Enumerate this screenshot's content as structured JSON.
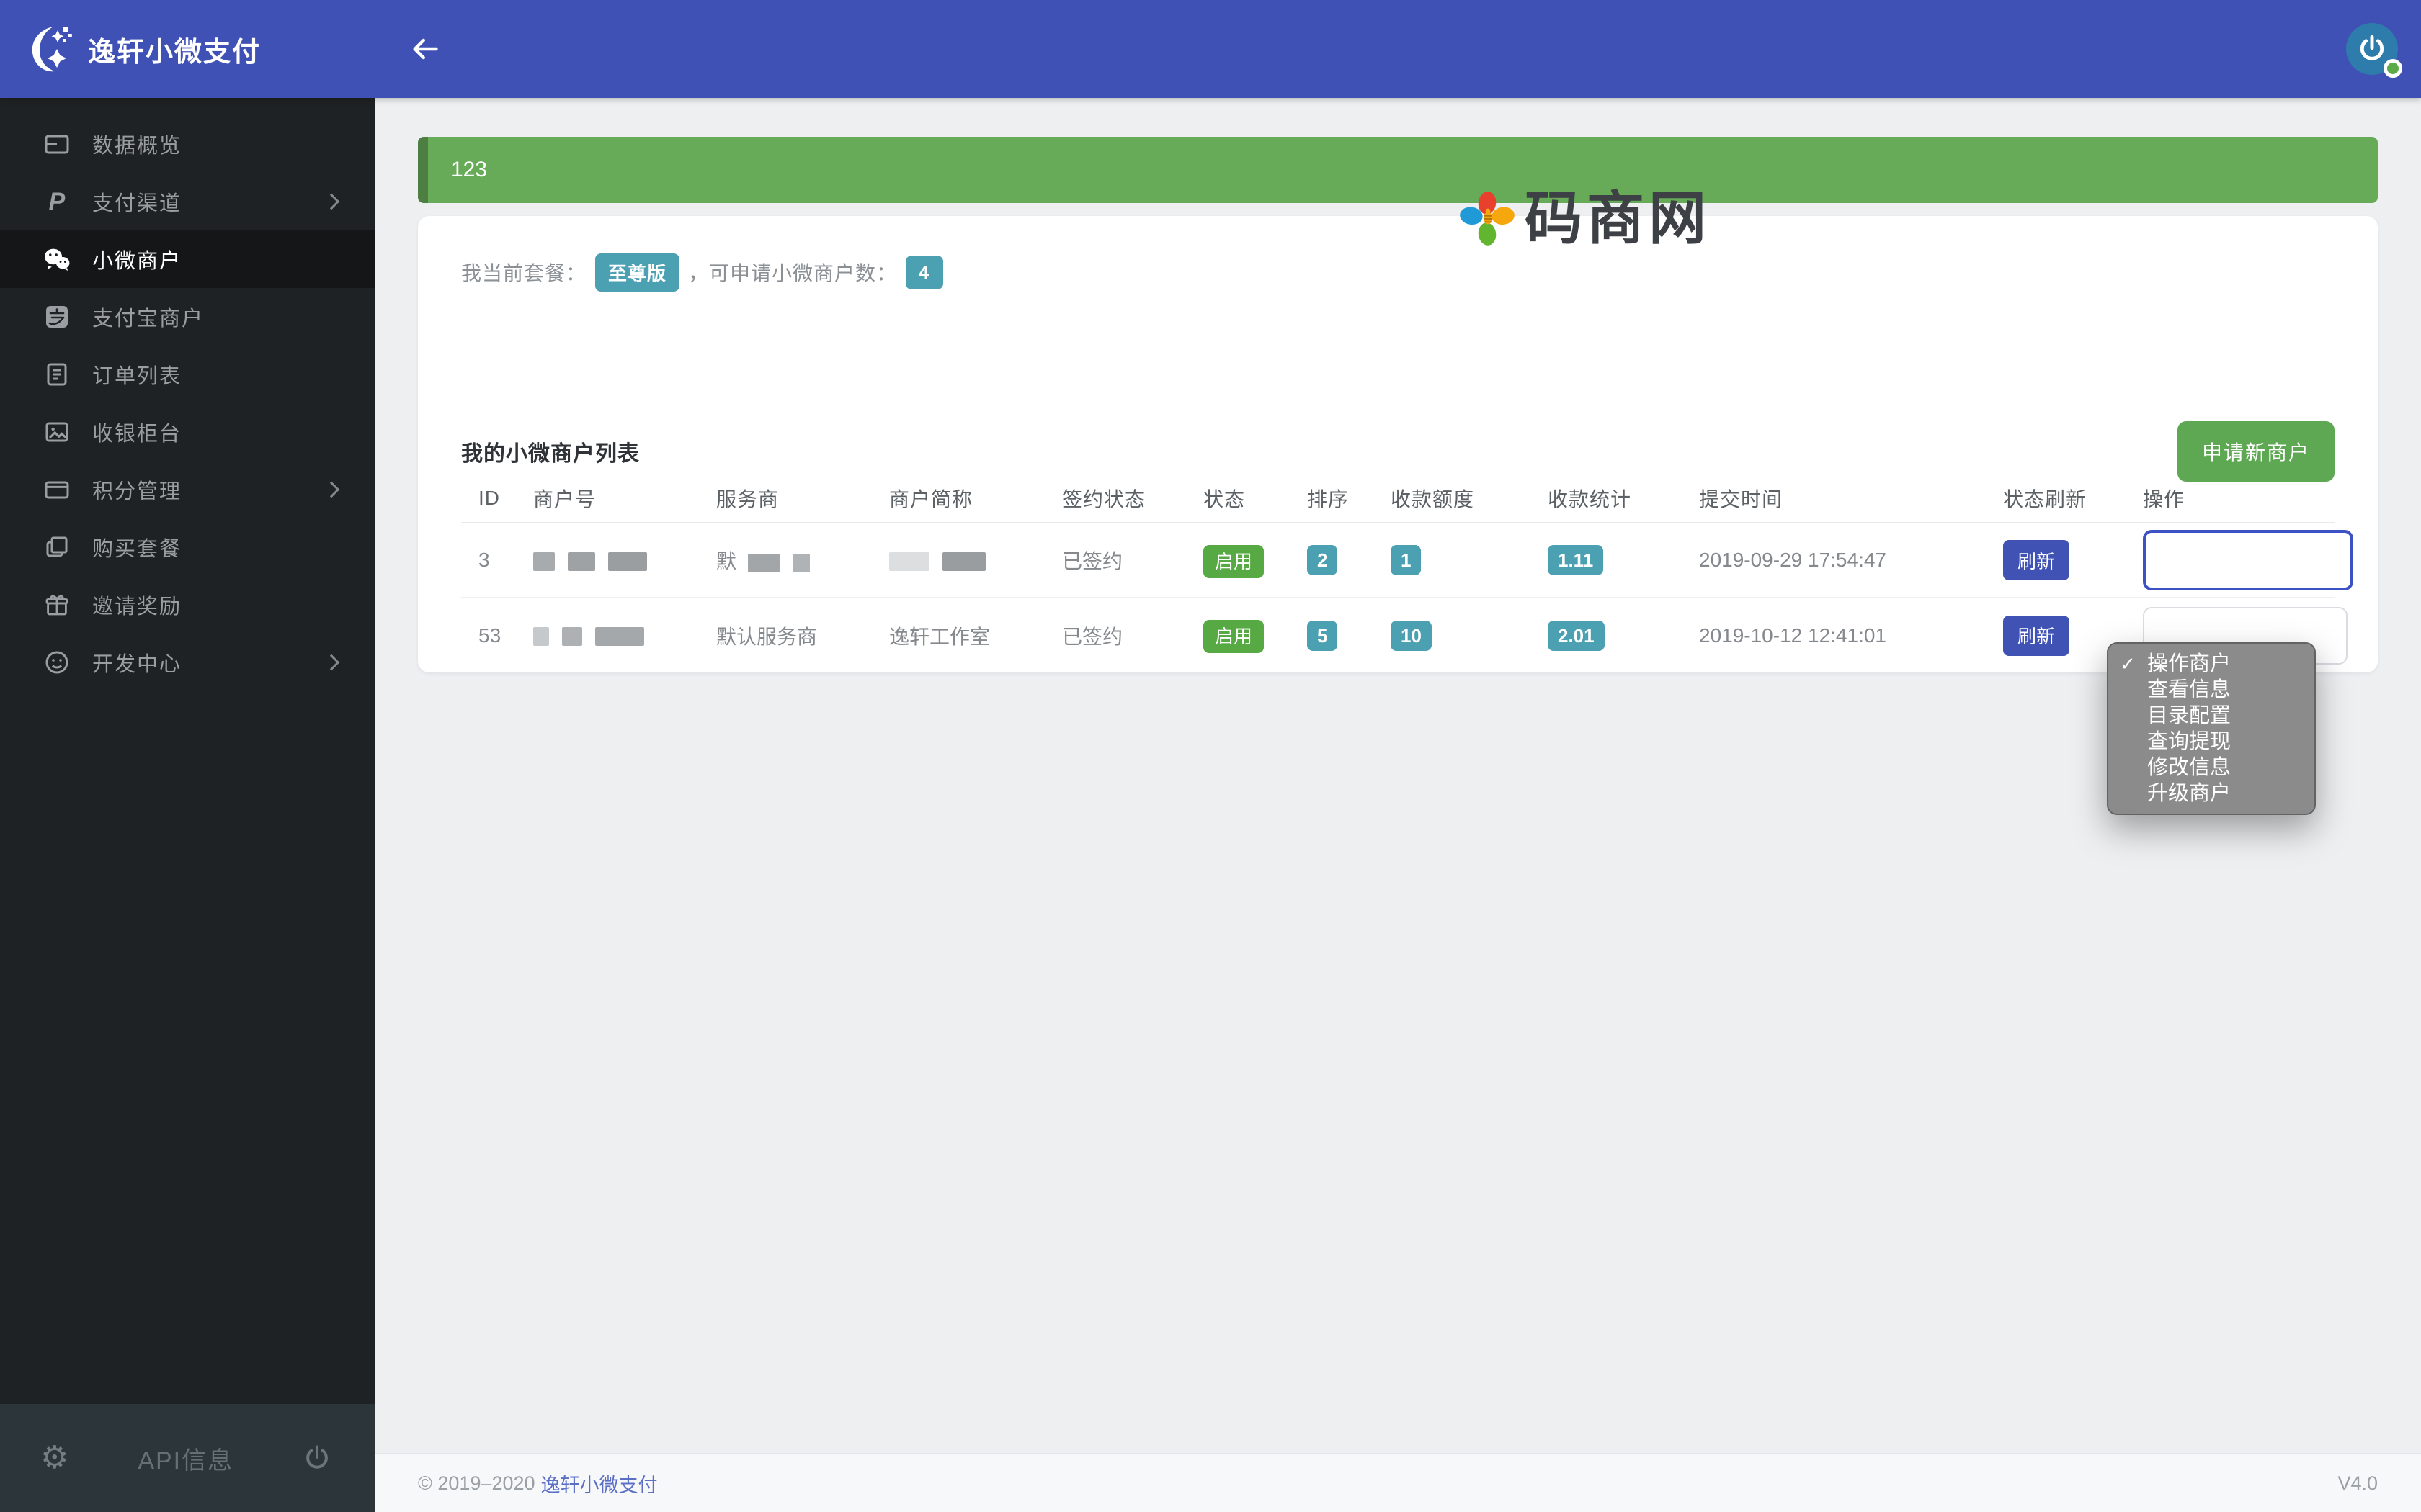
{
  "topbar": {
    "brand": "逸轩小微支付"
  },
  "sidebar": {
    "items": [
      {
        "label": "数据概览",
        "icon": "data-overview-card-icon"
      },
      {
        "label": "支付渠道",
        "icon": "paypal-p-icon",
        "chevron": true
      },
      {
        "label": "小微商户",
        "icon": "wechat-icon",
        "active": true
      },
      {
        "label": "支付宝商户",
        "icon": "alipay-icon"
      },
      {
        "label": "订单列表",
        "icon": "order-list-icon"
      },
      {
        "label": "收银柜台",
        "icon": "cashier-picture-icon"
      },
      {
        "label": "积分管理",
        "icon": "points-card-icon",
        "chevron": true
      },
      {
        "label": "购买套餐",
        "icon": "buy-package-icon"
      },
      {
        "label": "邀请奖励",
        "icon": "gift-icon"
      },
      {
        "label": "开发中心",
        "icon": "dev-center-smiley-icon",
        "chevron": true
      }
    ],
    "bottom": {
      "api_label": "API信息",
      "icons": [
        "gear-icon",
        "power-icon"
      ]
    }
  },
  "banner": {
    "text": "123"
  },
  "watermark": {
    "text": "码商网",
    "petal_colors": [
      "#e8402d",
      "#1f9ad6",
      "#f5a70d",
      "#62b52e"
    ]
  },
  "plan": {
    "prefix": "我当前套餐：",
    "plan_badge": "至尊版",
    "middle": "，可申请小微商户数：",
    "count_badge": "4"
  },
  "merchant_table": {
    "title": "我的小微商户列表",
    "new_button": "申请新商户",
    "columns": [
      "ID",
      "商户号",
      "服务商",
      "商户简称",
      "签约状态",
      "状态",
      "排序",
      "收款额度",
      "收款统计",
      "提交时间",
      "状态刷新",
      "操作"
    ],
    "rows": [
      {
        "id": "3",
        "provider_prefix": "默",
        "sign_status": "已签约",
        "status": "启用",
        "sort": "2",
        "quota": "1",
        "stats": "1.11",
        "submitted": "2019-09-29 17:54:47",
        "refresh": "刷新"
      },
      {
        "id": "53",
        "provider": "默认服务商",
        "short_name": "逸轩工作室",
        "sign_status": "已签约",
        "status": "启用",
        "sort": "5",
        "quota": "10",
        "stats": "2.01",
        "submitted": "2019-10-12 12:41:01",
        "refresh": "刷新"
      }
    ]
  },
  "action_menu": {
    "check": "✓",
    "options": [
      {
        "label": "操作商户",
        "checked": true
      },
      {
        "label": "查看信息"
      },
      {
        "label": "目录配置"
      },
      {
        "label": "查询提现"
      },
      {
        "label": "修改信息"
      },
      {
        "label": "升级商户"
      }
    ]
  },
  "page_footer": {
    "copyright": "© 2019–2020",
    "brand_link": "逸轩小微支付",
    "version": "V4.0"
  },
  "colors": {
    "topbar": "#3f51b5",
    "sidebar": "#1f2224",
    "banner_green": "#67ab59",
    "badge_teal": "#4ba0b2",
    "badge_green": "#57a943",
    "button_green": "#5ea853",
    "button_indigo": "#4053b4",
    "link": "#5b6fc6"
  }
}
